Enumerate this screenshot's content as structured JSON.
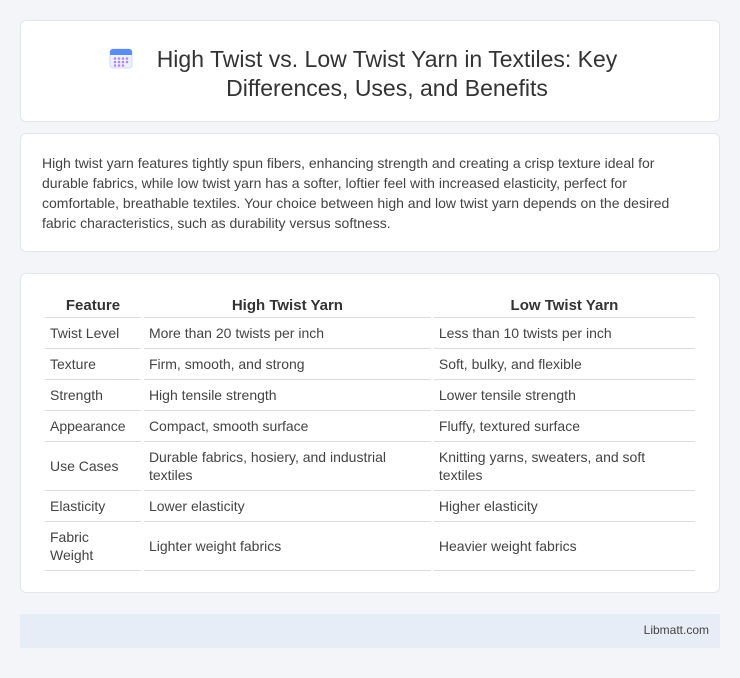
{
  "header": {
    "icon": "calendar-icon",
    "title": "High Twist vs. Low Twist Yarn in Textiles: Key Differences, Uses, and Benefits"
  },
  "summary": {
    "text": "High twist yarn features tightly spun fibers, enhancing strength and creating a crisp texture ideal for durable fabrics, while low twist yarn has a softer, loftier feel with increased elasticity, perfect for comfortable, breathable textiles. Your choice between high and low twist yarn depends on the desired fabric characteristics, such as durability versus softness."
  },
  "table": {
    "headers": [
      "Feature",
      "High Twist Yarn",
      "Low Twist Yarn"
    ],
    "rows": [
      [
        "Twist Level",
        "More than 20 twists per inch",
        "Less than 10 twists per inch"
      ],
      [
        "Texture",
        "Firm, smooth, and strong",
        "Soft, bulky, and flexible"
      ],
      [
        "Strength",
        "High tensile strength",
        "Lower tensile strength"
      ],
      [
        "Appearance",
        "Compact, smooth surface",
        "Fluffy, textured surface"
      ],
      [
        "Use Cases",
        "Durable fabrics, hosiery, and industrial textiles",
        "Knitting yarns, sweaters, and soft textiles"
      ],
      [
        "Elasticity",
        "Lower elasticity",
        "Higher elasticity"
      ],
      [
        "Fabric Weight",
        "Lighter weight fabrics",
        "Heavier weight fabrics"
      ]
    ]
  },
  "footer": {
    "site": "Libmatt.com"
  },
  "colors": {
    "background": "#f3f5f9",
    "card": "#ffffff",
    "footer": "#e7edf6",
    "icon_top": "#5b8def",
    "icon_grid": "#b388e8"
  }
}
